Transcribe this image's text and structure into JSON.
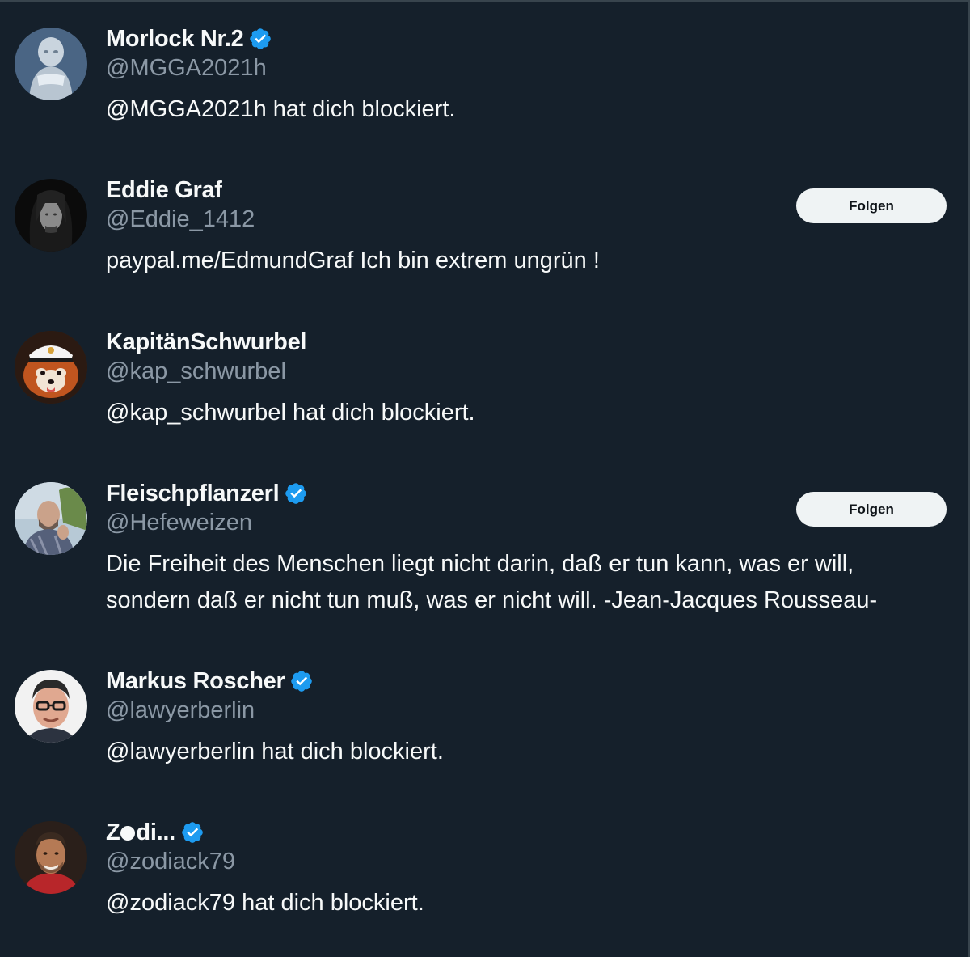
{
  "accent_verified": "#1d9bf0",
  "follow_button_bg": "#eff3f4",
  "users": [
    {
      "display_name": "Morlock Nr.2",
      "verified": true,
      "handle": "@MGGA2021h",
      "bio": "@MGGA2021h hat dich blockiert.",
      "avatar_icon": "silver-surfer-avatar"
    },
    {
      "display_name": "Eddie Graf",
      "verified": false,
      "handle": "@Eddie_1412",
      "bio": "paypal.me/EdmundGraf Ich bin extrem ungrün !",
      "follow_label": "Folgen",
      "avatar_icon": "long-hair-man-avatar"
    },
    {
      "display_name": "KapitänSchwurbel",
      "verified": false,
      "handle": "@kap_schwurbel",
      "bio": "@kap_schwurbel hat dich blockiert.",
      "avatar_icon": "red-panda-captain-avatar"
    },
    {
      "display_name": "Fleischpflanzerl",
      "verified": true,
      "handle": "@Hefeweizen",
      "bio_line1": "Die Freiheit des Menschen liegt nicht darin, daß er tun kann, was er will,",
      "bio_line2": "sondern daß er nicht tun muß, was er nicht will. -Jean-Jacques Rousseau-",
      "follow_label": "Folgen",
      "avatar_icon": "bearded-man-avatar"
    },
    {
      "display_name": "Markus Roscher",
      "verified": true,
      "handle": "@lawyerberlin",
      "bio": "@lawyerberlin hat dich blockiert.",
      "avatar_icon": "man-glasses-avatar"
    },
    {
      "display_name_prefix": "Z",
      "display_name_suffix": "di...",
      "verified": true,
      "handle": "@zodiack79",
      "bio": "@zodiack79 hat dich blockiert.",
      "avatar_icon": "tattooed-man-avatar"
    }
  ]
}
